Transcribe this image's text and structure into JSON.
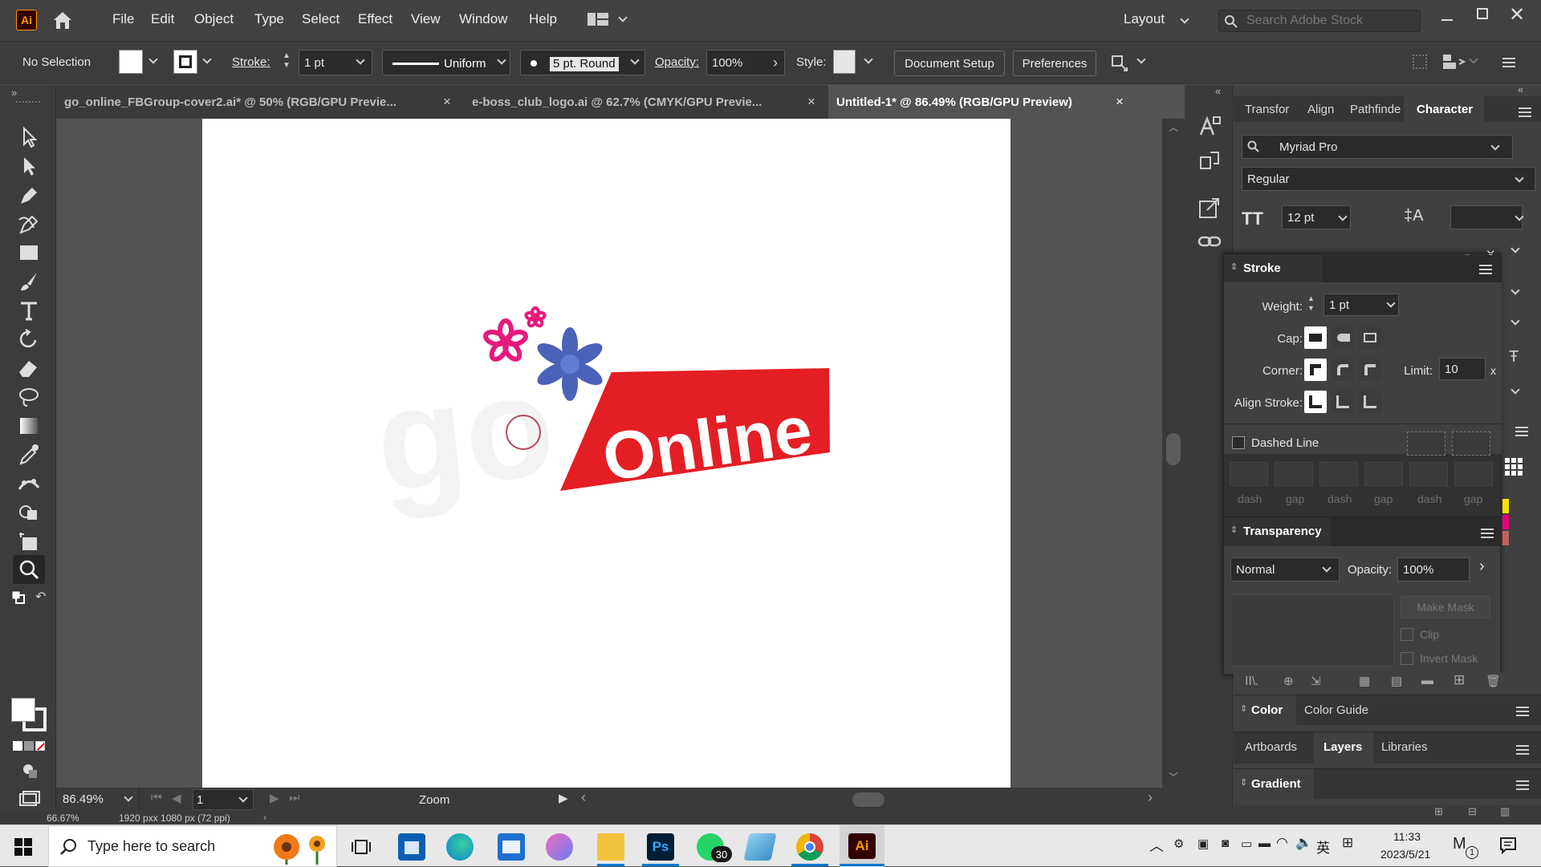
{
  "app": {
    "logo": "Ai"
  },
  "menu": [
    "File",
    "Edit",
    "Object",
    "Type",
    "Select",
    "Effect",
    "View",
    "Window",
    "Help"
  ],
  "workspace": {
    "label": "Layout"
  },
  "search": {
    "placeholder": "Search Adobe Stock"
  },
  "control": {
    "selection": "No Selection",
    "stroke_label": "Stroke:",
    "stroke_value": "1 pt",
    "profile": "Uniform",
    "brush": "5 pt. Round",
    "opacity_label": "Opacity:",
    "opacity_value": "100%",
    "style_label": "Style:",
    "document_setup": "Document Setup",
    "preferences": "Preferences"
  },
  "tabs": [
    {
      "label": "go_online_FBGroup-cover2.ai* @ 50% (RGB/GPU Previe..."
    },
    {
      "label": "e-boss_club_logo.ai @ 62.7% (CMYK/GPU Previe..."
    },
    {
      "label": "Untitled-1* @ 86.49% (RGB/GPU Preview)"
    }
  ],
  "tab_close": "×",
  "artwork": {
    "ghost_text": "go",
    "banner_text": "Online"
  },
  "status": {
    "zoom": "86.49%",
    "artboard": "1",
    "tool": "Zoom"
  },
  "bottom_info": {
    "zoom": "66.67%",
    "dimensions": "1920 pxx 1080 px (72 ppi)"
  },
  "character_panel": {
    "tabs": [
      "Transfor",
      "Align",
      "Pathfinde",
      "Character"
    ],
    "font": "Myriad Pro",
    "style": "Regular",
    "size": "12 pt"
  },
  "stroke_panel": {
    "title": "Stroke",
    "weight_label": "Weight:",
    "weight_value": "1 pt",
    "cap_label": "Cap:",
    "corner_label": "Corner:",
    "limit_label": "Limit:",
    "limit_value": "10",
    "limit_unit": "x",
    "align_label": "Align Stroke:",
    "dashed_label": "Dashed Line",
    "dash_labels": [
      "dash",
      "gap",
      "dash",
      "gap",
      "dash",
      "gap"
    ]
  },
  "transparency_panel": {
    "title": "Transparency",
    "blend_mode": "Normal",
    "opacity_label": "Opacity:",
    "opacity_value": "100%",
    "make_mask": "Make Mask",
    "clip": "Clip",
    "invert_mask": "Invert Mask"
  },
  "color_panel": {
    "tabs": [
      "Color",
      "Color Guide"
    ]
  },
  "layers_panel": {
    "tabs": [
      "Artboards",
      "Layers",
      "Libraries"
    ]
  },
  "gradient_panel": {
    "title": "Gradient"
  },
  "taskbar": {
    "search_placeholder": "Type here to search",
    "whatsapp_badge": "30",
    "time": "11:33",
    "date": "2023/5/21",
    "ime": "英",
    "notification_count": "1"
  },
  "colors": {
    "banner_red": "#e31e24",
    "flower_pink": "#e6197d",
    "flower_blue": "#4a62b8",
    "accent": "#0078d4"
  }
}
